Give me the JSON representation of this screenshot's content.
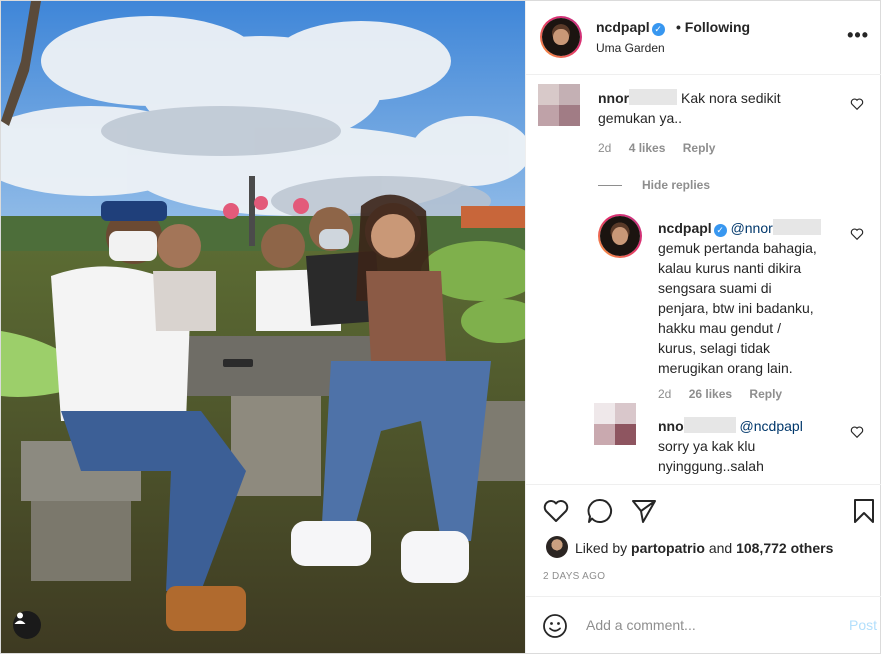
{
  "post": {
    "username": "ncdpapl",
    "follow_status": "• Following",
    "location": "Uma Garden",
    "more_icon": "ellipsis-horizontal-icon"
  },
  "comments": [
    {
      "user": "nnor",
      "text": "Kak nora sedikit gemukan ya..",
      "age": "2d",
      "likes": "4 likes",
      "reply_label": "Reply"
    }
  ],
  "hide_replies_label": "Hide replies",
  "replies": [
    {
      "user": "ncdpapl",
      "mention": "@nnor",
      "text_lines": [
        "gemuk pertanda bahagia,",
        "kalau kurus nanti dikira",
        "sengsara suami di",
        "penjara, btw ini badanku,",
        "hakku mau gendut /",
        "kurus, selagi tidak",
        "merugikan orang lain."
      ],
      "age": "2d",
      "likes": "26 likes",
      "reply_label": "Reply"
    },
    {
      "user": "nno",
      "mention": "@ncdpapl",
      "text_lines": [
        "sorry ya kak klu",
        "nyinggung..salah"
      ]
    }
  ],
  "likes": {
    "prefix": "Liked by",
    "user": "partopatrio",
    "middle": "and",
    "count": "108,772 others"
  },
  "date": "2 DAYS AGO",
  "add_comment": {
    "placeholder": "Add a comment...",
    "post_label": "Post"
  },
  "colors": {
    "verified": "#3897f0",
    "mention": "#00376b",
    "post_disabled": "#b2dffc",
    "meta": "#8e8e8e"
  }
}
